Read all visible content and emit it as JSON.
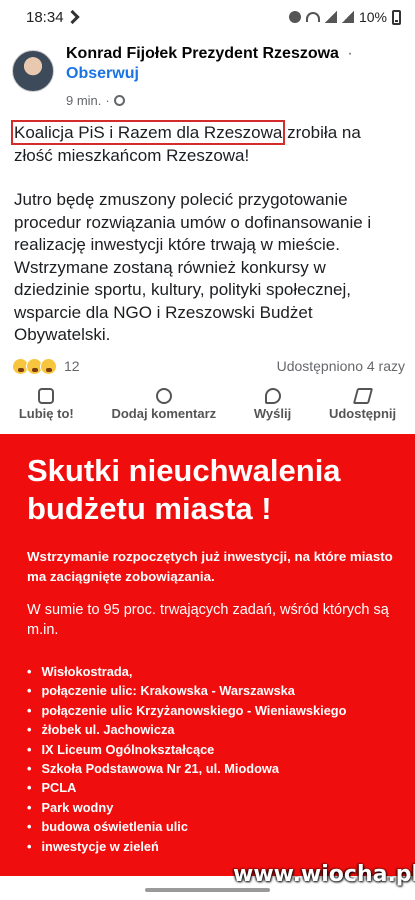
{
  "status_bar": {
    "time": "18:34",
    "battery": "10%"
  },
  "post": {
    "author": "Konrad Fijołek Prezydent Rzeszowa",
    "separator": "·",
    "follow_label": "Obserwuj",
    "time_ago": "9 min.",
    "meta_dot": "·",
    "text_highlight": "Koalicja PiS i Razem dla Rzeszowa",
    "text_line1_rest": " zrobiła na złość mieszkańcom Rzeszowa!",
    "text_para2": "Jutro będę zmuszony polecić przygotowanie procedur rozwiązania umów o dofinansowanie i realizację inwestycji które trwają w mieście. Wstrzymane zostaną również konkursy w dziedzinie sportu, kultury, polityki społecznej, wsparcie dla NGO i Rzeszowski Budżet Obywatelski.",
    "reaction_count": "12",
    "shares": "Udostępniono 4 razy"
  },
  "actions": {
    "like": "Lubię to!",
    "comment": "Dodaj komentarz",
    "send": "Wyślij",
    "share": "Udostępnij"
  },
  "graphic": {
    "background_color": "#f00d0d",
    "title": "Skutki nieuchwalenia budżetu miasta !",
    "subtitle": "Wstrzymanie rozpoczętych już inwestycji, na które miasto ma zaciągnięte zobowiązania.",
    "text": "W sumie to 95 proc. trwających zadań, wśród których są m.in.",
    "items": [
      "Wisłokostrada,",
      "połączenie ulic: Krakowska - Warszawska",
      "połączenie ulic Krzyżanowskiego - Wieniawskiego",
      "żłobek ul. Jachowicza",
      "IX Liceum Ogólnokształcące",
      "Szkoła Podstawowa Nr 21, ul. Miodowa",
      "PCLA",
      "Park wodny",
      "budowa oświetlenia ulic",
      "inwestycje w zieleń"
    ]
  },
  "watermark": "www.wiocha.pl"
}
